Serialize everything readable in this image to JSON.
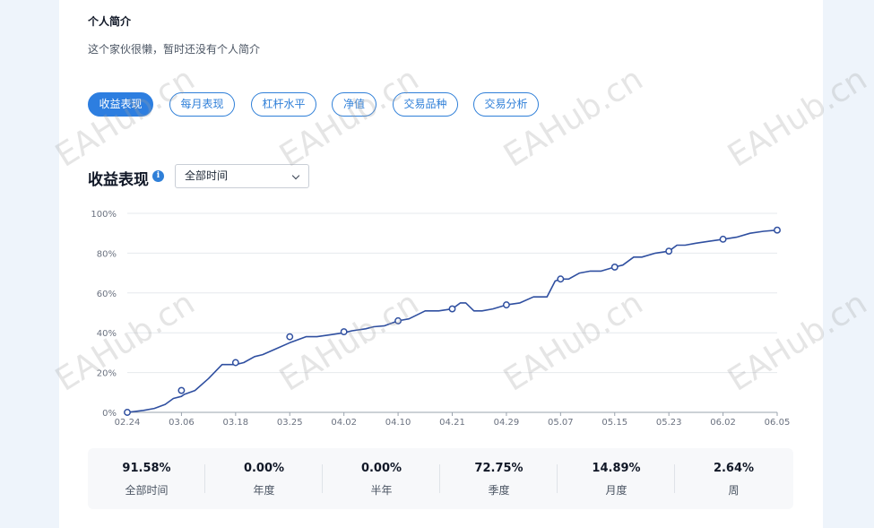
{
  "profile": {
    "bio_title": "个人简介",
    "bio_text": "这个家伙很懒，暂时还没有个人简介"
  },
  "tabs": [
    {
      "label": "收益表现",
      "active": true
    },
    {
      "label": "每月表现",
      "active": false
    },
    {
      "label": "杠杆水平",
      "active": false
    },
    {
      "label": "净值",
      "active": false
    },
    {
      "label": "交易品种",
      "active": false
    },
    {
      "label": "交易分析",
      "active": false
    }
  ],
  "section": {
    "title": "收益表现",
    "info_icon": "info-icon",
    "period_select": "全部时间"
  },
  "chart_data": {
    "type": "line",
    "title": "",
    "xlabel": "",
    "ylabel": "",
    "ylim": [
      0,
      100
    ],
    "y_ticks": [
      "0%",
      "20%",
      "40%",
      "60%",
      "80%",
      "100%"
    ],
    "x_ticks": [
      "02.24",
      "03.06",
      "03.18",
      "03.25",
      "04.02",
      "04.10",
      "04.21",
      "04.29",
      "05.07",
      "05.15",
      "05.23",
      "06.02",
      "06.05"
    ],
    "grid": true,
    "line_color": "#2f4fa0",
    "series": [
      {
        "name": "",
        "x": [
          0,
          0.3,
          0.5,
          0.7,
          0.85,
          1,
          1.05,
          1.25,
          1.5,
          1.75,
          2,
          2.15,
          2.35,
          2.5,
          2.75,
          3,
          3.2,
          3.3,
          3.5,
          3.75,
          4,
          4.15,
          4.4,
          4.55,
          4.75,
          5,
          5.2,
          5.5,
          5.75,
          6,
          6.15,
          6.25,
          6.4,
          6.55,
          6.75,
          7,
          7.25,
          7.5,
          7.75,
          7.9,
          8,
          8.15,
          8.35,
          8.55,
          8.75,
          9,
          9.15,
          9.35,
          9.5,
          9.75,
          10,
          10.15,
          10.3,
          10.5,
          10.75,
          11,
          11.25,
          11.5,
          11.75,
          12
        ],
        "y": [
          0,
          1,
          2,
          4,
          7,
          8,
          9,
          11,
          17,
          24,
          24,
          25,
          28,
          29,
          32,
          35,
          37,
          38,
          38,
          39,
          40,
          41,
          42,
          43,
          43.5,
          46,
          47,
          51,
          51,
          52,
          55,
          55,
          51,
          51,
          52,
          54,
          55,
          58,
          58,
          66,
          67,
          67,
          70,
          71,
          71,
          73,
          74,
          78,
          78,
          80,
          81,
          84,
          84,
          85,
          86,
          87,
          88,
          90,
          91,
          91.58
        ]
      }
    ],
    "markers": [
      {
        "x": 0,
        "y": 0
      },
      {
        "x": 1,
        "y": 11
      },
      {
        "x": 2,
        "y": 25
      },
      {
        "x": 3,
        "y": 38
      },
      {
        "x": 4,
        "y": 40.5
      },
      {
        "x": 5,
        "y": 46
      },
      {
        "x": 6,
        "y": 52
      },
      {
        "x": 7,
        "y": 54
      },
      {
        "x": 8,
        "y": 67
      },
      {
        "x": 9,
        "y": 73
      },
      {
        "x": 10,
        "y": 81
      },
      {
        "x": 11,
        "y": 87
      },
      {
        "x": 12,
        "y": 91.58
      }
    ]
  },
  "stats": [
    {
      "value": "91.58%",
      "label": "全部时间"
    },
    {
      "value": "0.00%",
      "label": "年度"
    },
    {
      "value": "0.00%",
      "label": "半年"
    },
    {
      "value": "72.75%",
      "label": "季度"
    },
    {
      "value": "14.89%",
      "label": "月度"
    },
    {
      "value": "2.64%",
      "label": "周"
    }
  ],
  "watermark": "EAHub.cn"
}
